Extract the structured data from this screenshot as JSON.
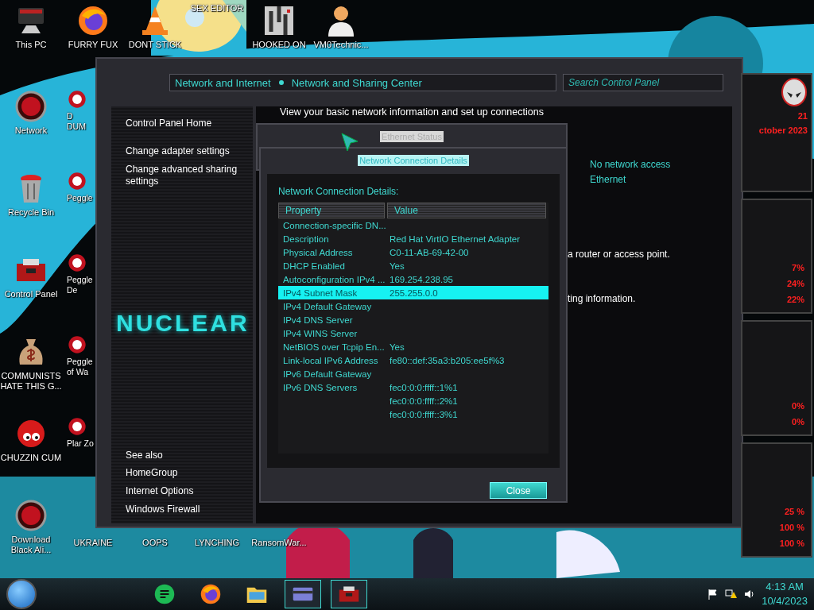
{
  "desktop": {
    "icons_top": [
      {
        "kind": "monitor",
        "label": "This PC"
      },
      {
        "kind": "browser",
        "label": "FURRY FUX"
      },
      {
        "kind": "cone",
        "label": "DONT STICK"
      },
      {
        "kind": "none",
        "label": "SEX EDITOR"
      },
      {
        "kind": "maze",
        "label": "HOOKED ON"
      },
      {
        "kind": "person",
        "label": "VM0Technic..."
      }
    ],
    "icons_left": [
      {
        "kind": "globe",
        "label": "Network"
      },
      {
        "kind": "trash",
        "label": "Recycle Bin"
      },
      {
        "kind": "toolbox",
        "label": "Control Panel"
      },
      {
        "kind": "money",
        "label": "COMMUNISTS HATE THIS G..."
      },
      {
        "kind": "creature",
        "label": "CHUZZIN CUM"
      },
      {
        "kind": "globe",
        "label": "Download Black Ali..."
      }
    ],
    "icons_col2": [
      {
        "kind": "app",
        "label": "D DUM"
      },
      {
        "kind": "app",
        "label": "Peggle"
      },
      {
        "kind": "app",
        "label": "Peggle De"
      },
      {
        "kind": "app",
        "label": "Peggle of Wa"
      },
      {
        "kind": "app",
        "label": "Plar Zo"
      }
    ],
    "icons_bottom": [
      {
        "label": "UKRAINE"
      },
      {
        "label": "OOPS"
      },
      {
        "label": "LYNCHING"
      },
      {
        "label": "RansomWar..."
      }
    ]
  },
  "window": {
    "breadcrumb": [
      "Network and Internet",
      "Network and Sharing Center"
    ],
    "search": {
      "placeholder": "Search Control Panel"
    },
    "sidebar": {
      "links": [
        "Control Panel Home",
        "Change adapter settings",
        "Change advanced sharing settings"
      ],
      "logo_text": "NUCLEAR",
      "see_also_title": "See also",
      "see_also": [
        "HomeGroup",
        "Internet Options",
        "Windows Firewall"
      ]
    },
    "heading": "View your basic network information and set up connections",
    "access": "No network access",
    "connection": "Ethernet",
    "partial_texts": [
      "a router or access point.",
      "ting information."
    ]
  },
  "status_dialog": {
    "title": "Ethernet Status"
  },
  "details_dialog": {
    "title": "Network Connection Details",
    "label": "Network Connection Details:",
    "columns": [
      "Property",
      "Value"
    ],
    "rows": [
      {
        "property": "Connection-specific DN...",
        "selected": false
      },
      {
        "property": "Description",
        "value": "Red Hat VirtIO Ethernet Adapter",
        "selected": false
      },
      {
        "property": "Physical Address",
        "value": "C0-11-AB-69-42-00",
        "selected": false
      },
      {
        "property": "DHCP Enabled",
        "value": "Yes",
        "selected": false
      },
      {
        "property": "Autoconfiguration IPv4 ...",
        "value": "169.254.238.95",
        "selected": false
      },
      {
        "property": "IPv4 Subnet Mask",
        "value": "255.255.0.0",
        "selected": true
      },
      {
        "property": "IPv4 Default Gateway",
        "selected": false
      },
      {
        "property": "IPv4 DNS Server",
        "selected": false
      },
      {
        "property": "IPv4 WINS Server",
        "selected": false
      },
      {
        "property": "NetBIOS over Tcpip En...",
        "value": "Yes",
        "selected": false
      },
      {
        "property": "Link-local IPv6 Address",
        "value": "fe80::def:35a3:b205:ee5f%3",
        "selected": false
      },
      {
        "property": "IPv6 Default Gateway",
        "selected": false
      },
      {
        "property": "IPv6 DNS Servers",
        "value": "fec0:0:0:ffff::1%1",
        "selected": false
      },
      {
        "value": "fec0:0:0:ffff::2%1",
        "selected": false
      },
      {
        "value": "fec0:0:0:ffff::3%1",
        "selected": false
      }
    ],
    "close_button": "Close"
  },
  "gadget": {
    "day": "21",
    "month": "ctober 2023",
    "panels": [
      {
        "readings": [
          "7%",
          "24%",
          "22%"
        ]
      },
      {
        "readings": [
          "0%",
          "0%"
        ]
      },
      {
        "readings": [
          "25 %",
          "100 %",
          "100 %"
        ]
      }
    ]
  },
  "taskbar": {
    "apps": [
      {
        "kind": "chat",
        "selected": false
      },
      {
        "kind": "browser",
        "selected": false
      },
      {
        "kind": "folder",
        "selected": false
      },
      {
        "kind": "card",
        "selected": true
      },
      {
        "kind": "toolbox",
        "selected": true
      }
    ],
    "time": "4:13 AM",
    "date": "10/4/2023"
  }
}
